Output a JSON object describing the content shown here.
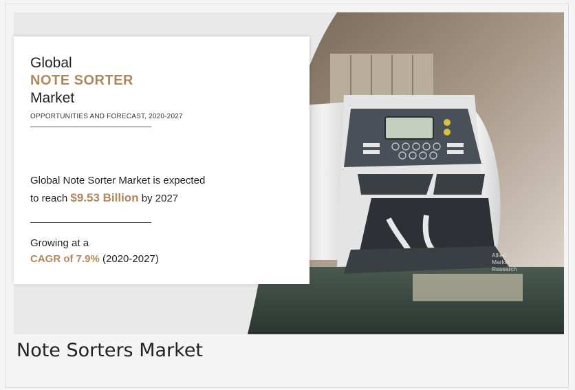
{
  "banner": {
    "heading_line1": "Global",
    "heading_brand": "NOTE SORTER",
    "heading_line3": "Market",
    "subheading": "OPPORTUNITIES AND FORECAST, 2020-2027",
    "expect_line1": "Global Note Sorter Market is expected",
    "expect_prefix": "to reach ",
    "expect_value": "$9.53 Billion",
    "expect_suffix": " by 2027",
    "growth_line1": "Growing at a",
    "growth_cagr": "CAGR of 7.9%",
    "growth_period": " (2020-2027)",
    "watermark": [
      "Allied",
      "Market",
      "Research"
    ]
  },
  "caption": "Note Sorters Market",
  "colors": {
    "accent": "#b0875c",
    "text": "#222222",
    "background": "#f4f4f4"
  }
}
